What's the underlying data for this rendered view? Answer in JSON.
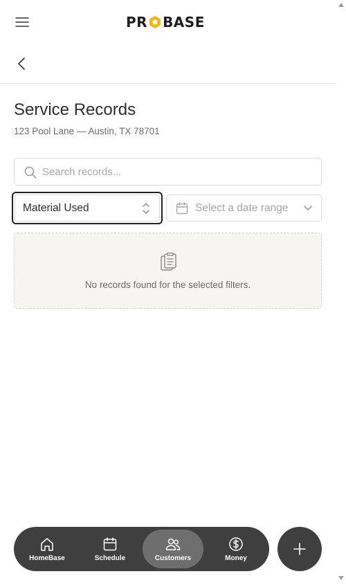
{
  "header": {
    "logo_text_left": "PR",
    "logo_text_right": "BASE",
    "menu_icon": "hamburger-icon",
    "back_icon": "chevron-left-icon"
  },
  "page": {
    "title": "Service Records",
    "address": "123 Pool Lane — Austin, TX 78701"
  },
  "filters": {
    "search_placeholder": "Search records...",
    "type_select_value": "Material Used",
    "date_placeholder": "Select a date range"
  },
  "empty_state": {
    "icon": "clipboard-icon",
    "message": "No records found for the selected filters."
  },
  "bottom_nav": {
    "items": [
      {
        "label": "HomeBase",
        "icon": "home-icon",
        "active": false
      },
      {
        "label": "Schedule",
        "icon": "calendar-icon",
        "active": false
      },
      {
        "label": "Customers",
        "icon": "users-icon",
        "active": true
      },
      {
        "label": "Money",
        "icon": "dollar-icon",
        "active": false
      }
    ],
    "fab_icon": "plus-icon"
  },
  "colors": {
    "brand_accent": "#f5b21a",
    "nav_bg": "#3f3f3f",
    "nav_active": "#6e6e6e"
  }
}
